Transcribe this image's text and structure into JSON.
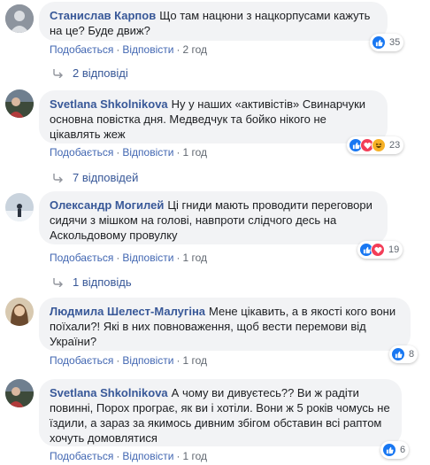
{
  "ui": {
    "like_label": "Подобається",
    "reply_label": "Відповісти",
    "separator": "·"
  },
  "colors": {
    "name": "#385898",
    "link": "#4267b2",
    "bubble": "#f2f3f5",
    "like": "#1877f2",
    "love": "#f33e58",
    "haha": "#f7b125"
  },
  "comments": [
    {
      "author": "Станислав Карпов",
      "text": "Що там нацюни з нацкорпусами кажуть на це? Буде движ?",
      "time": "2 год",
      "reactions": [
        "like-icon"
      ],
      "reaction_count": "35",
      "replies": "2 відповіді"
    },
    {
      "author": "Svetlana Shkolnikova",
      "text": "Ну у наших «активістів» Свинарчуки основна повістка дня. Медведчук та бойко нікого не цікавлять жеж",
      "time": "1 год",
      "reactions": [
        "like-icon",
        "love-icon",
        "haha-icon"
      ],
      "reaction_count": "23",
      "replies": "7 відповідей"
    },
    {
      "author": "Олександр Могилей",
      "text": "Ці гниди мають проводити переговори сидячи з мішком на голові, навпроти слідчого десь на Аскольдовому провулку",
      "time": "1 год",
      "reactions": [
        "like-icon",
        "love-icon"
      ],
      "reaction_count": "19",
      "replies": "1 відповідь"
    },
    {
      "author": "Людмила Шелест-Малугіна",
      "text": "Мене цікавить, а в якості кого вони поїхали?! Які в них повноваження, щоб вести перемови від України?",
      "time": "1 год",
      "reactions": [
        "like-icon"
      ],
      "reaction_count": "8",
      "replies": ""
    },
    {
      "author": "Svetlana Shkolnikova",
      "text": "А чому ви дивуєтесь?? Ви ж радіти повинні, Порох програє, як ви і хотіли. Вони ж 5 років чомусь не їздили, а зараз за якимось дивним збігом обставин всі раптом хочуть домовлятися",
      "time": "1 год",
      "reactions": [
        "like-icon"
      ],
      "reaction_count": "6",
      "replies": ""
    }
  ]
}
